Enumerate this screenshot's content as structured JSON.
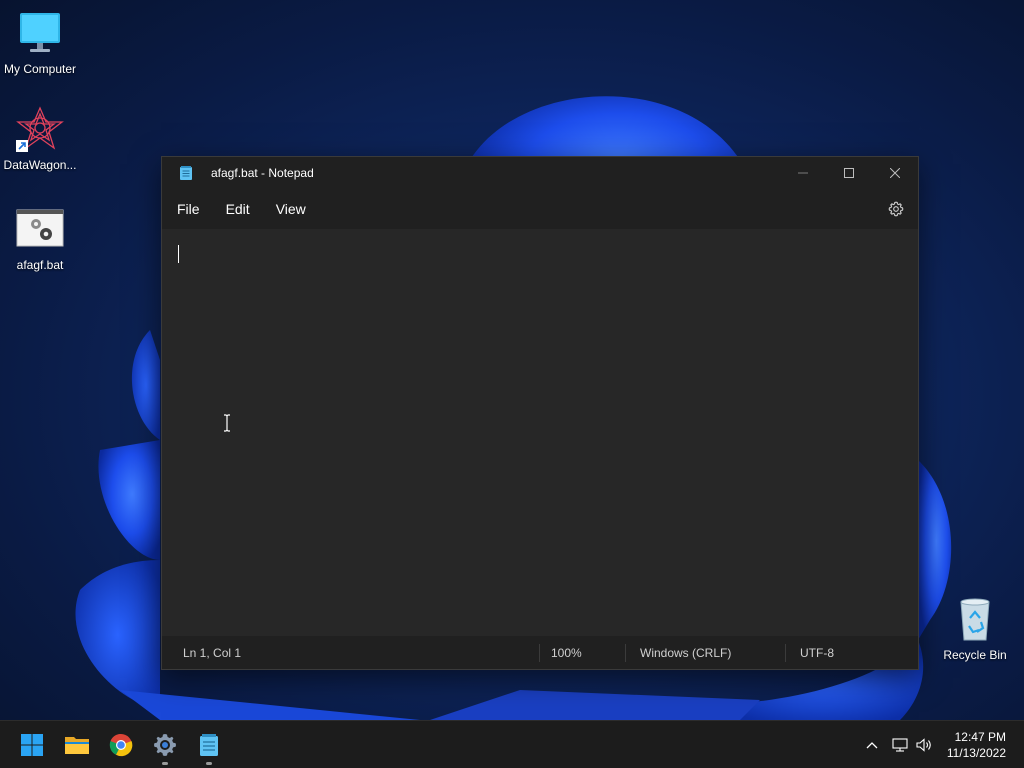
{
  "desktop": {
    "icons": [
      {
        "label": "My Computer",
        "icon": "monitor-icon"
      },
      {
        "label": "DataWagon...",
        "icon": "datawagon-icon"
      },
      {
        "label": "afagf.bat",
        "icon": "batch-file-icon"
      },
      {
        "label": "Recycle Bin",
        "icon": "recycle-bin-icon"
      }
    ]
  },
  "window": {
    "title": "afagf.bat - Notepad",
    "menu": [
      "File",
      "Edit",
      "View"
    ],
    "content": "",
    "status": {
      "position": "Ln 1, Col 1",
      "zoom": "100%",
      "line_ending": "Windows (CRLF)",
      "encoding": "UTF-8"
    }
  },
  "taskbar": {
    "apps": [
      "start-icon",
      "file-explorer-icon",
      "chrome-icon",
      "settings-icon",
      "notepad-icon"
    ],
    "clock": {
      "time": "12:47 PM",
      "date": "11/13/2022"
    }
  },
  "colors": {
    "accent": "#1a5cff",
    "window_bg": "#272727",
    "titlebar_bg": "#202020",
    "taskbar_bg": "#1c1c1c"
  }
}
